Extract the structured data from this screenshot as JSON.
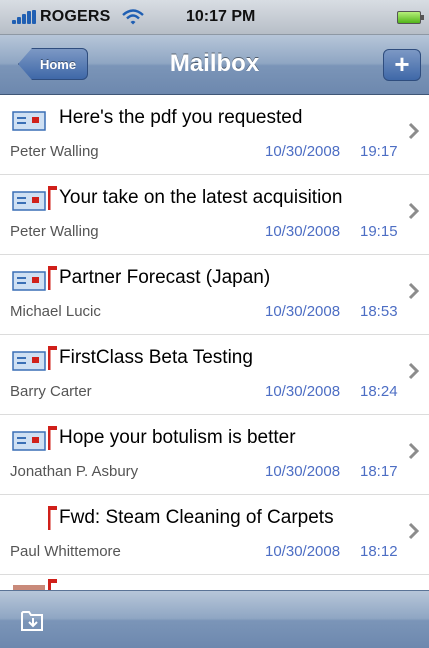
{
  "status_bar": {
    "carrier": "ROGERS",
    "time": "10:17 PM"
  },
  "nav": {
    "back_label": "Home",
    "title": "Mailbox",
    "add_label": "+"
  },
  "messages": [
    {
      "subject": "Here's the pdf you requested",
      "sender": "Peter Walling",
      "date": "10/30/2008",
      "time": "19:17",
      "flagged": false,
      "has_envelope": true
    },
    {
      "subject": "Your take on the latest acquisition",
      "sender": "Peter Walling",
      "date": "10/30/2008",
      "time": "19:15",
      "flagged": true,
      "has_envelope": true
    },
    {
      "subject": "Partner Forecast (Japan)",
      "sender": "Michael Lucic",
      "date": "10/30/2008",
      "time": "18:53",
      "flagged": true,
      "has_envelope": true
    },
    {
      "subject": "FirstClass Beta Testing",
      "sender": "Barry Carter",
      "date": "10/30/2008",
      "time": "18:24",
      "flagged": true,
      "has_envelope": true
    },
    {
      "subject": "Hope your botulism is better",
      "sender": "Jonathan P. Asbury",
      "date": "10/30/2008",
      "time": "18:17",
      "flagged": true,
      "has_envelope": true
    },
    {
      "subject": "Fwd: Steam Cleaning of Carpets",
      "sender": "Paul Whittemore",
      "date": "10/30/2008",
      "time": "18:12",
      "flagged": true,
      "has_envelope": false
    }
  ],
  "colors": {
    "nav_blue": "#7b95b8",
    "date_blue": "#4d6ec4",
    "flag_red": "#d0201a"
  },
  "toolbar": {
    "icon": "folder-move-icon"
  }
}
